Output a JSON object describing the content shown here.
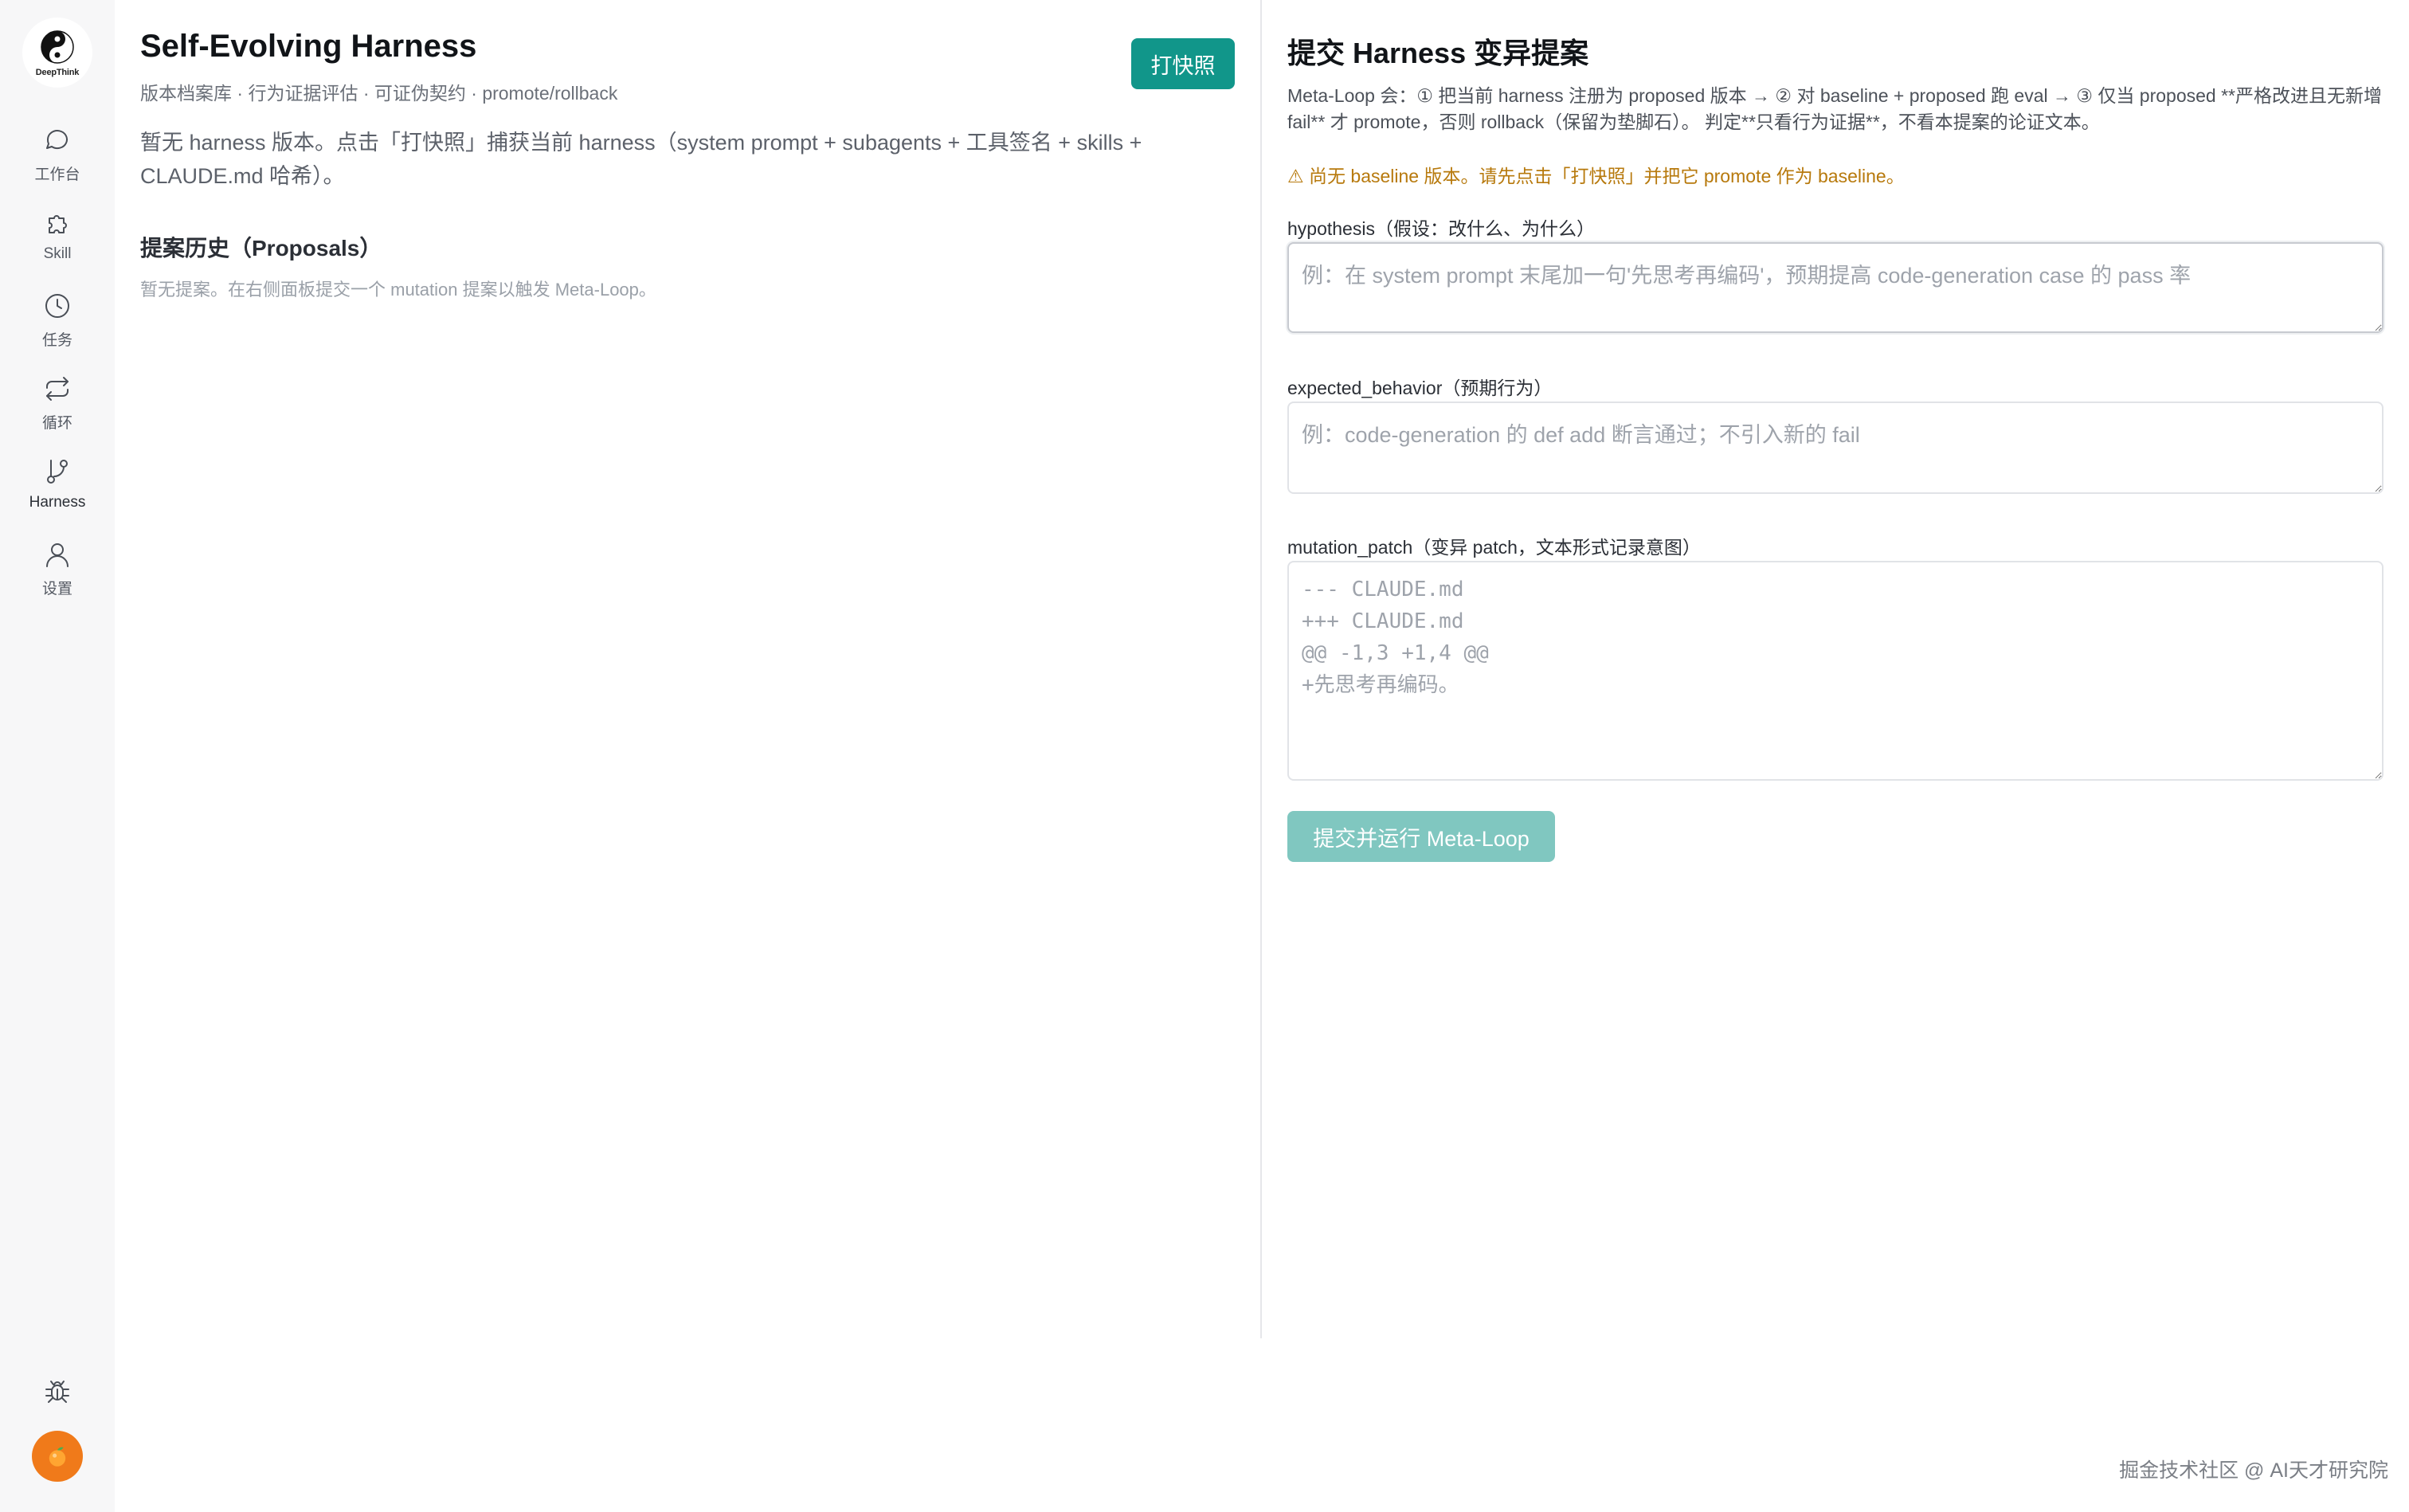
{
  "sidebar": {
    "logo_text": "DeepThink",
    "items": [
      {
        "label": "工作台",
        "icon": "chat-bubble-icon"
      },
      {
        "label": "Skill",
        "icon": "puzzle-icon"
      },
      {
        "label": "任务",
        "icon": "clock-icon"
      },
      {
        "label": "循环",
        "icon": "repeat-icon"
      },
      {
        "label": "Harness",
        "icon": "git-branch-icon"
      },
      {
        "label": "设置",
        "icon": "user-icon"
      }
    ],
    "active": "Harness",
    "bottom_icons": [
      "bug-icon",
      "avatar-orange-icon"
    ]
  },
  "left": {
    "title": "Self-Evolving Harness",
    "subtitle": "版本档案库 · 行为证据评估 · 可证伪契约 · promote/rollback",
    "snapshot_button": "打快照",
    "empty_message": "暂无 harness 版本。点击「打快照」捕获当前 harness（system prompt + subagents + 工具签名 + skills + CLAUDE.md 哈希）。",
    "proposals_title": "提案历史（Proposals）",
    "proposals_empty": "暂无提案。在右侧面板提交一个 mutation 提案以触发 Meta-Loop。"
  },
  "right": {
    "title": "提交 Harness 变异提案",
    "description": "Meta-Loop 会：① 把当前 harness 注册为 proposed 版本 → ② 对 baseline + proposed 跑 eval → ③ 仅当 proposed **严格改进且无新增 fail** 才 promote，否则 rollback（保留为垫脚石）。 判定**只看行为证据**，不看本提案的论证文本。",
    "warning": "⚠ 尚无 baseline 版本。请先点击「打快照」并把它 promote 作为 baseline。",
    "hypothesis_label": "hypothesis（假设：改什么、为什么）",
    "hypothesis_placeholder": "例：在 system prompt 末尾加一句'先思考再编码'，预期提高 code-generation case 的 pass 率",
    "expected_label": "expected_behavior（预期行为）",
    "expected_placeholder": "例：code-generation 的 def add 断言通过；不引入新的 fail",
    "patch_label": "mutation_patch（变异 patch，文本形式记录意图）",
    "patch_placeholder": "--- CLAUDE.md\n+++ CLAUDE.md\n@@ -1,3 +1,4 @@\n+先思考再编码。",
    "submit_button": "提交并运行 Meta-Loop"
  },
  "watermark": "掘金技术社区 @ AI天才研究院",
  "colors": {
    "primary": "#11968a",
    "primary_disabled": "#80c7c0",
    "warning": "#b7790c",
    "avatar": "#f07a1a"
  }
}
